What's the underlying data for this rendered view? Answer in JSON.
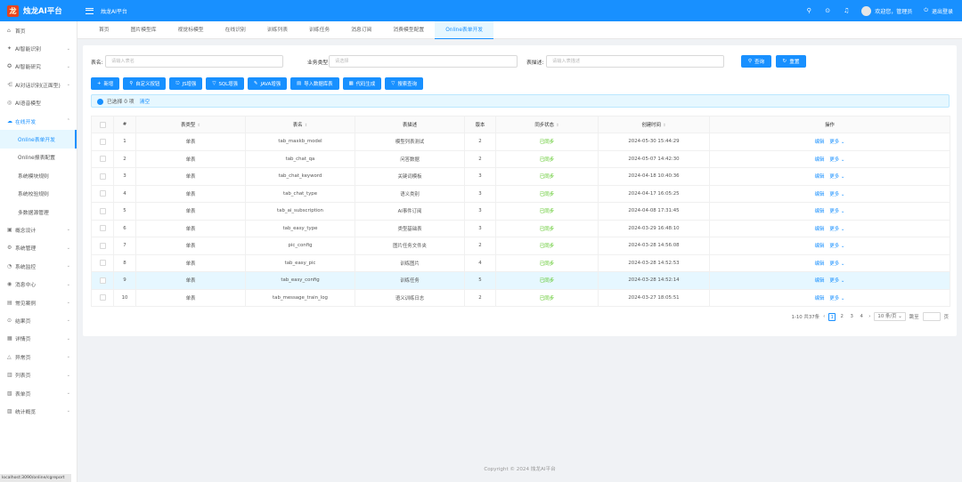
{
  "app": {
    "logo_text": "烛龙AI平台",
    "breadcrumb": "烛龙AI平台"
  },
  "header": {
    "user_label": "欢迎您，管理员",
    "logout_label": "退出登录"
  },
  "sidebar": {
    "items": [
      {
        "label": "首页",
        "icon": "home-icon",
        "glyph": "⌂",
        "has_children": false
      },
      {
        "label": "AI智能识别",
        "icon": "scan-icon",
        "glyph": "✦",
        "has_children": true
      },
      {
        "label": "AI智能研究",
        "icon": "research-icon",
        "glyph": "✪",
        "has_children": true
      },
      {
        "label": "AI对话识别(正面型)",
        "icon": "share-icon",
        "glyph": "⋲",
        "has_children": true
      },
      {
        "label": "AI语音模型",
        "icon": "voice-icon",
        "glyph": "◎",
        "has_children": false
      },
      {
        "label": "在线开发",
        "icon": "cloud-icon",
        "glyph": "☁",
        "has_children": true,
        "open": true
      }
    ],
    "sub_items": [
      {
        "label": "Online表单开发",
        "active": true
      },
      {
        "label": "Online报表配置",
        "active": false
      },
      {
        "label": "系统模块规则",
        "active": false
      },
      {
        "label": "系统校验规则",
        "active": false
      },
      {
        "label": "多数据源管理",
        "active": false
      }
    ],
    "items_after": [
      {
        "label": "概念设计",
        "icon": "design-icon",
        "glyph": "▣",
        "has_children": true
      },
      {
        "label": "系统管理",
        "icon": "settings-icon",
        "glyph": "⚙",
        "has_children": true
      },
      {
        "label": "系统监控",
        "icon": "monitor-icon",
        "glyph": "◔",
        "has_children": true
      },
      {
        "label": "消息中心",
        "icon": "message-icon",
        "glyph": "◉",
        "has_children": true
      },
      {
        "label": "常见案例",
        "icon": "case-icon",
        "glyph": "▤",
        "has_children": true
      },
      {
        "label": "结果页",
        "icon": "check-circle-icon",
        "glyph": "⊙",
        "has_children": true
      },
      {
        "label": "详情页",
        "icon": "profile-icon",
        "glyph": "▦",
        "has_children": true
      },
      {
        "label": "异常页",
        "icon": "warning-icon",
        "glyph": "△",
        "has_children": true
      },
      {
        "label": "列表页",
        "icon": "table-icon",
        "glyph": "▥",
        "has_children": true
      },
      {
        "label": "表单页",
        "icon": "form-icon",
        "glyph": "▧",
        "has_children": true
      },
      {
        "label": "统计概览",
        "icon": "dashboard-icon",
        "glyph": "▨",
        "has_children": true
      }
    ]
  },
  "status_url": "localhost:3090/online/cgreport",
  "tabs": [
    {
      "label": "首页",
      "active": false
    },
    {
      "label": "图片模型库",
      "active": false
    },
    {
      "label": "视觉标模型",
      "active": false
    },
    {
      "label": "在线识别",
      "active": false
    },
    {
      "label": "训练列表",
      "active": false
    },
    {
      "label": "训练任务",
      "active": false
    },
    {
      "label": "消息订阅",
      "active": false
    },
    {
      "label": "消费模型配置",
      "active": false
    },
    {
      "label": "Online表单开发",
      "active": true
    }
  ],
  "search": {
    "table_label": "表名:",
    "table_placeholder": "请输入表名",
    "type_label": "业务类型:",
    "type_placeholder": "请选择",
    "desc_label": "表描述:",
    "desc_placeholder": "请输入表描述",
    "query_label": "查询",
    "reset_label": "重置"
  },
  "toolbar": [
    {
      "label": "新增",
      "glyph": "+"
    },
    {
      "label": "自定义按钮",
      "glyph": "⚲"
    },
    {
      "label": "JS增强",
      "glyph": "⎋"
    },
    {
      "label": "SQL增强",
      "glyph": "▽"
    },
    {
      "label": "JAVA增强",
      "glyph": "✎"
    },
    {
      "label": "导入数据库表",
      "glyph": "▤"
    },
    {
      "label": "代码生成",
      "glyph": "▦"
    },
    {
      "label": "搜索查询",
      "glyph": "▽"
    }
  ],
  "alert": {
    "selected_text": "已选择 0 项",
    "clear_label": "清空"
  },
  "table": {
    "columns": [
      "",
      "#",
      "表类型",
      "表名",
      "表描述",
      "版本",
      "同步状态",
      "创建时间",
      "操作"
    ],
    "rows": [
      {
        "n": "1",
        "type": "单表",
        "name": "tab_maxkb_model",
        "desc": "模型列表测试",
        "ver": "2",
        "sync": "已同步",
        "time": "2024-05-30 15:44:29"
      },
      {
        "n": "2",
        "type": "单表",
        "name": "tab_chat_qa",
        "desc": "问答数据",
        "ver": "2",
        "sync": "已同步",
        "time": "2024-05-07 14:42:30"
      },
      {
        "n": "3",
        "type": "单表",
        "name": "tab_chat_keyword",
        "desc": "关键词模板",
        "ver": "3",
        "sync": "已同步",
        "time": "2024-04-18 10:40:36"
      },
      {
        "n": "4",
        "type": "单表",
        "name": "tab_chat_type",
        "desc": "语义类别",
        "ver": "3",
        "sync": "已同步",
        "time": "2024-04-17 16:05:25"
      },
      {
        "n": "5",
        "type": "单表",
        "name": "tab_ai_subscription",
        "desc": "AI事件订阅",
        "ver": "3",
        "sync": "已同步",
        "time": "2024-04-08 17:31:45"
      },
      {
        "n": "6",
        "type": "单表",
        "name": "tab_easy_type",
        "desc": "类型基础表",
        "ver": "3",
        "sync": "已同步",
        "time": "2024-03-29 16:48:10"
      },
      {
        "n": "7",
        "type": "单表",
        "name": "pic_config",
        "desc": "图片任务文件夹",
        "ver": "2",
        "sync": "已同步",
        "time": "2024-03-28 14:56:08"
      },
      {
        "n": "8",
        "type": "单表",
        "name": "tab_easy_pic",
        "desc": "训练图片",
        "ver": "4",
        "sync": "已同步",
        "time": "2024-03-28 14:52:53"
      },
      {
        "n": "9",
        "type": "单表",
        "name": "tab_easy_config",
        "desc": "训练任务",
        "ver": "5",
        "sync": "已同步",
        "time": "2024-03-28 14:52:14",
        "highlight": true
      },
      {
        "n": "10",
        "type": "单表",
        "name": "tab_message_train_log",
        "desc": "语义训练日志",
        "ver": "2",
        "sync": "已同步",
        "time": "2024-03-27 18:05:51"
      }
    ],
    "edit_label": "编辑",
    "more_label": "更多"
  },
  "pagination": {
    "total_text": "1-10 共37条",
    "pages": [
      "1",
      "2",
      "3",
      "4"
    ],
    "current": "1",
    "page_size": "10 条/页",
    "jump_label": "跳至",
    "page_suffix": "页"
  },
  "footer": "Copyright © 2024 烛龙AI平台",
  "colors": {
    "primary": "#1890ff",
    "success": "#52c41a",
    "logo": "#e8441e"
  }
}
